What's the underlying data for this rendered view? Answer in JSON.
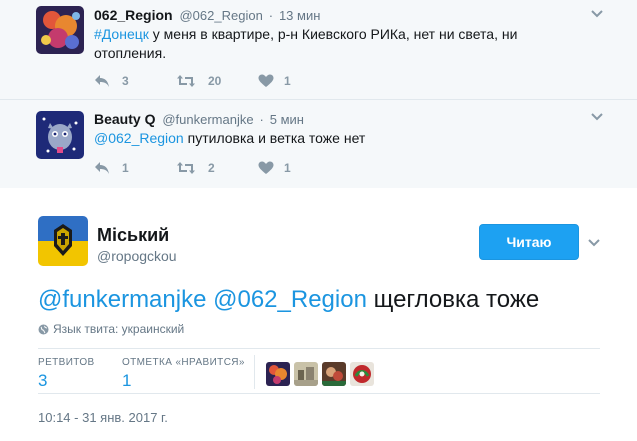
{
  "context_tweets": [
    {
      "fullname": "062_Region",
      "screenname": "@062_Region",
      "time": "13 мин",
      "text_parts": [
        {
          "text": "#Донецк",
          "link": true
        },
        {
          "text": " у меня в квартире, р-н Киевского РИКа, нет ни света, ни отопления.",
          "link": false
        }
      ],
      "replies": "3",
      "retweets": "20",
      "likes": "1"
    },
    {
      "fullname": "Beauty Q",
      "screenname": "@funkermanjke",
      "time": "5 мин",
      "text_parts": [
        {
          "text": "@062_Region",
          "link": true
        },
        {
          "text": " путиловка и ветка тоже нет",
          "link": false
        }
      ],
      "replies": "1",
      "retweets": "2",
      "likes": "1"
    }
  ],
  "main_tweet": {
    "fullname": "Міський",
    "screenname": "@ropogckou",
    "follow_label": "Читаю",
    "mention1": "@funkermanjke",
    "mention2": "@062_Region",
    "text": "щегловка тоже",
    "language": "Язык твита: украинский",
    "retweets_label": "РЕТВИТОВ",
    "retweets_count": "3",
    "likes_label": "ОТМЕТКА «НРАВИТСЯ»",
    "likes_count": "1",
    "timestamp": "10:14 - 31 янв. 2017 г."
  },
  "colors": {
    "link": "#1b95e0",
    "button": "#1da1f2",
    "context_bg": "#f5f8fa",
    "muted": "#8899a6"
  },
  "icons": {
    "reply": "reply-icon",
    "retweet": "retweet-icon",
    "like": "heart-icon",
    "caret": "chevron-down-icon",
    "globe": "globe-icon"
  }
}
